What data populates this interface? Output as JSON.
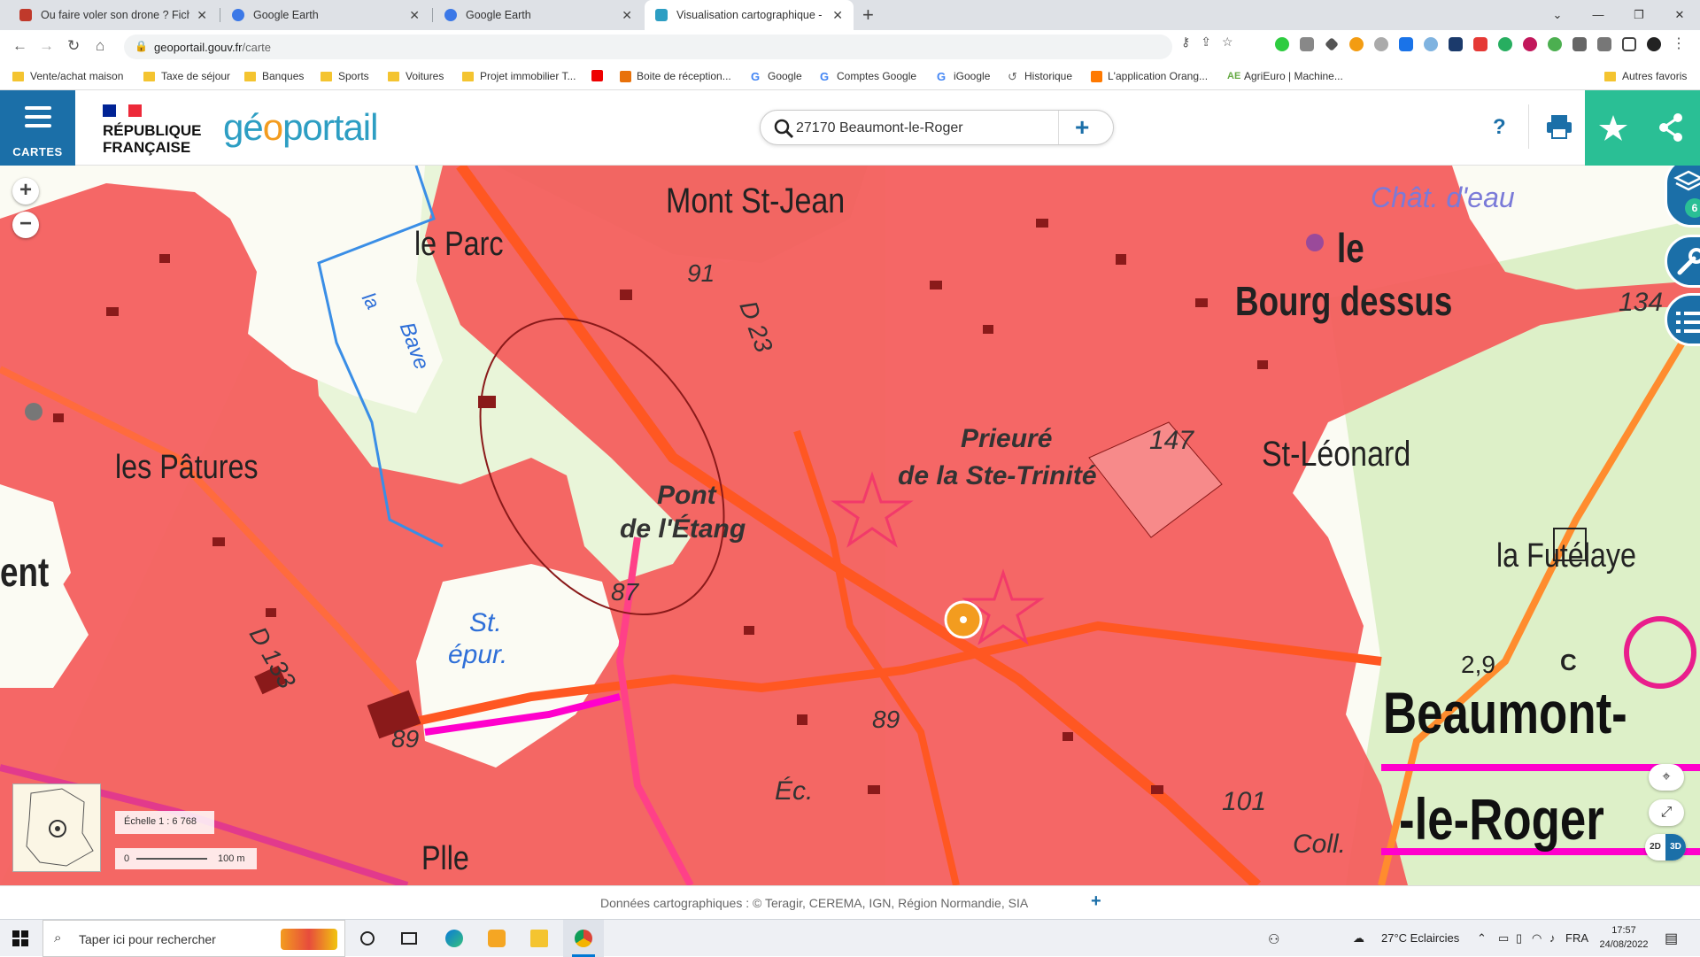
{
  "browser": {
    "tabs": [
      {
        "title": "Ou faire voler son drone ? Fiche",
        "favicon_color": "#c0392b",
        "active": false
      },
      {
        "title": "Google Earth",
        "favicon_color": "#3b78e7",
        "active": false
      },
      {
        "title": "Google Earth",
        "favicon_color": "#3b78e7",
        "active": false
      },
      {
        "title": "Visualisation cartographique - G",
        "favicon_color": "#2d9ec3",
        "active": true
      }
    ],
    "url_host": "geoportail.gouv.fr",
    "url_path": "/carte",
    "bookmarks": [
      {
        "label": "Vente/achat maison",
        "type": "folder"
      },
      {
        "label": "Taxe de séjour",
        "type": "folder"
      },
      {
        "label": "Banques",
        "type": "folder"
      },
      {
        "label": "Sports",
        "type": "folder"
      },
      {
        "label": "Voitures",
        "type": "folder"
      },
      {
        "label": "Projet immobilier T...",
        "type": "folder"
      },
      {
        "label": "Boite de réception...",
        "type": "mail"
      },
      {
        "label": "Google",
        "type": "google"
      },
      {
        "label": "Comptes Google",
        "type": "google"
      },
      {
        "label": "iGoogle",
        "type": "google"
      },
      {
        "label": "Historique",
        "type": "history"
      },
      {
        "label": "L'application Orang...",
        "type": "orange"
      },
      {
        "label": "AgriEuro | Machine...",
        "type": "agri"
      },
      {
        "label": "Autres favoris",
        "type": "folder"
      }
    ]
  },
  "geoportail": {
    "menu_label": "CARTES",
    "republique_line1": "RÉPUBLIQUE",
    "republique_line2": "FRANÇAISE",
    "logo_part1": "gé",
    "logo_part2": "o",
    "logo_part3": "portail",
    "search_value": "27170 Beaumont-le-Roger",
    "help_label": "?",
    "layers_count": "6"
  },
  "map": {
    "labels": {
      "mont_st_jean": "Mont St-Jean",
      "le_parc": "le Parc",
      "la": "la",
      "bave": "Bave",
      "chat_deau": "Chât. d'eau",
      "le": "le",
      "bourg_dessus": "Bourg dessus",
      "alt_134": "134",
      "alt_91": "91",
      "d23": "D 23",
      "les_patures": "les Pâtures",
      "prieure": "Prieuré",
      "ste_trinite": "de la Ste-Trinité",
      "alt_147": "147",
      "st_leonard": "St-Léonard",
      "pont": "Pont",
      "de_letang": "de l'Étang",
      "ent": "ent",
      "la_futelaye": "la Futélaye",
      "alt_87": "87",
      "st": "St.",
      "epur": "épur.",
      "d133": "D 133",
      "val_29": "2,9",
      "c_letter": "C",
      "beaumont": "Beaumont-",
      "le_roger": "-le-Roger",
      "alt_89a": "89",
      "alt_89b": "89",
      "ec": "Éc.",
      "alt_101": "101",
      "coll": "Coll.",
      "plle": "Plle"
    },
    "scale_label": "Échelle 1 : 6 768",
    "scale_start": "0",
    "scale_end": "100 m",
    "btn_2d": "2D",
    "btn_3d": "3D",
    "restricted_zone_color": "#f45a5a"
  },
  "attribution": {
    "text": "Données cartographiques : ©     Teragir,  CEREMA,  IGN,  Région Normandie,  SIA"
  },
  "taskbar": {
    "search_placeholder": "Taper ici pour rechercher",
    "weather": "27°C  Eclaircies",
    "language": "FRA",
    "time": "17:57",
    "date": "24/08/2022"
  }
}
